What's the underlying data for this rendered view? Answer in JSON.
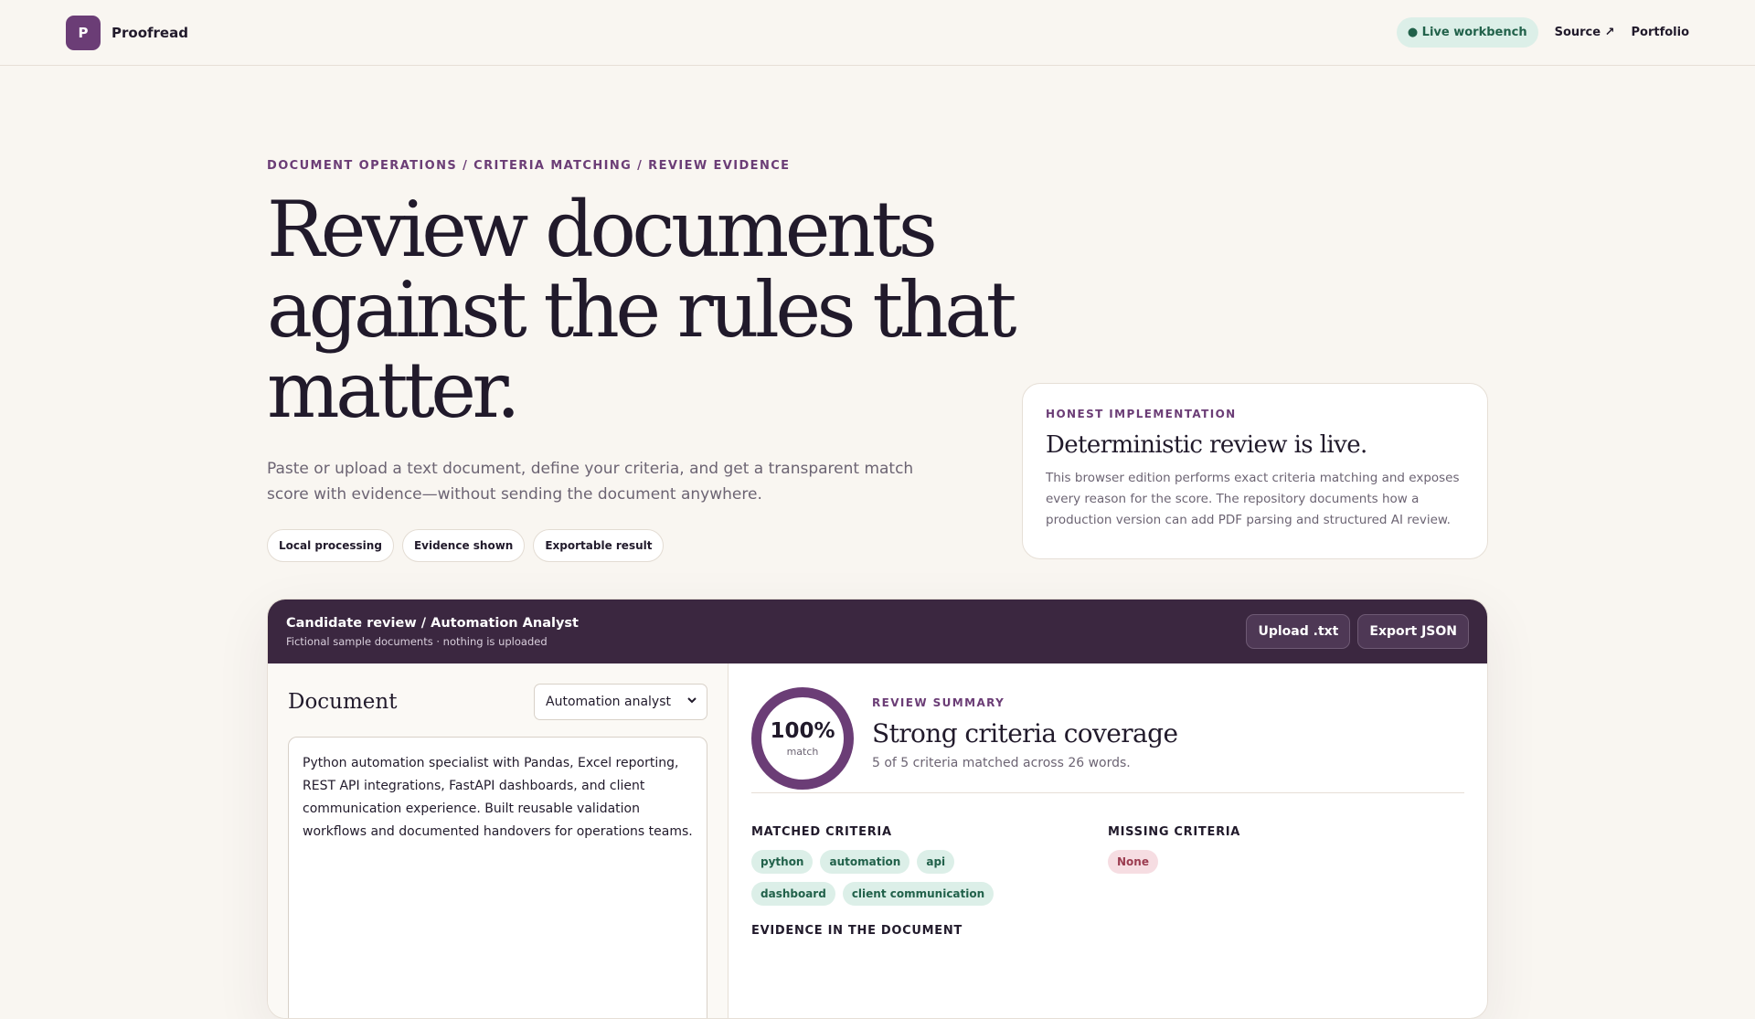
{
  "nav": {
    "logo_letter": "P",
    "brand": "Proofread",
    "live_label": "● Live workbench",
    "source_label": "Source ↗",
    "portfolio_label": "Portfolio"
  },
  "hero": {
    "eyebrow": "DOCUMENT OPERATIONS / CRITERIA MATCHING / REVIEW EVIDENCE",
    "title_lines": [
      "Review documents",
      "against the rules that",
      "matter."
    ],
    "subtitle": "Paste or upload a text document, define your criteria, and get a transparent match score with evidence—without sending the document anywhere.",
    "chips": [
      "Local processing",
      "Evidence shown",
      "Exportable result"
    ]
  },
  "honest": {
    "eyebrow": "HONEST IMPLEMENTATION",
    "title": "Deterministic review is live.",
    "body": "This browser edition performs exact criteria matching and exposes every reason for the score. The repository documents how a production version can add PDF parsing and structured AI review."
  },
  "bench": {
    "title": "Candidate review / Automation Analyst",
    "subtitle": "Fictional sample documents · nothing is uploaded",
    "upload_label": "Upload .txt",
    "export_label": "Export JSON",
    "document_heading": "Document",
    "profile_selected": "Automation analyst",
    "document_text": "Python automation specialist with Pandas, Excel reporting, REST API integrations, FastAPI dashboards, and client communication experience. Built reusable validation workflows and documented handovers for operations teams.",
    "score_value": "100%",
    "score_label": "match",
    "summary_eyebrow": "REVIEW SUMMARY",
    "summary_title": "Strong criteria coverage",
    "summary_detail": "5 of 5 criteria matched across 26 words.",
    "matched_heading": "MATCHED CRITERIA",
    "missing_heading": "MISSING CRITERIA",
    "matched": [
      "python",
      "automation",
      "api",
      "dashboard",
      "client communication"
    ],
    "missing": [
      "None"
    ],
    "evidence_heading": "EVIDENCE IN THE DOCUMENT"
  },
  "colors": {
    "accent": "#6b3d76",
    "header_dark": "#3b2740",
    "match_bg": "#dcefe8",
    "match_text": "#21614a",
    "missing_bg": "#f6dde2",
    "page_bg": "#f9f6f1"
  }
}
